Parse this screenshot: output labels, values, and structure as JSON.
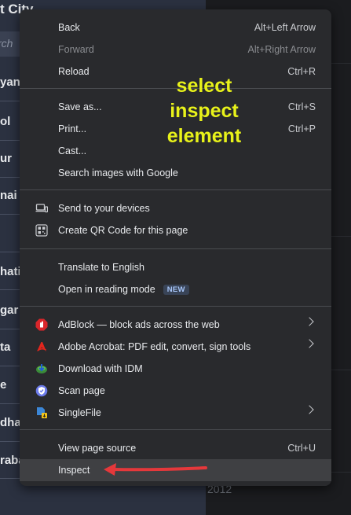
{
  "background": {
    "title_fragment": "t City",
    "search_placeholder_fragment": "rch",
    "cities": [
      "yana",
      "ol",
      "ur",
      "nai",
      "hati",
      "gar",
      "ta",
      "e",
      "dha",
      "raba"
    ],
    "year_fragment": "2012"
  },
  "annotation": {
    "line1": "select",
    "line2": "inspect",
    "line3": "element"
  },
  "menu": {
    "back": {
      "label": "Back",
      "shortcut": "Alt+Left Arrow"
    },
    "forward": {
      "label": "Forward",
      "shortcut": "Alt+Right Arrow"
    },
    "reload": {
      "label": "Reload",
      "shortcut": "Ctrl+R"
    },
    "save_as": {
      "label": "Save as...",
      "shortcut": "Ctrl+S"
    },
    "print": {
      "label": "Print...",
      "shortcut": "Ctrl+P"
    },
    "cast": {
      "label": "Cast..."
    },
    "search_images": {
      "label": "Search images with Google"
    },
    "send_devices": {
      "label": "Send to your devices",
      "icon": "devices-icon"
    },
    "qr_code": {
      "label": "Create QR Code for this page",
      "icon": "qr-code-icon"
    },
    "translate": {
      "label": "Translate to English"
    },
    "reading_mode": {
      "label": "Open in reading mode",
      "badge": "NEW"
    },
    "adblock": {
      "label": "AdBlock — block ads across the web",
      "icon": "adblock-icon",
      "color": "#d9262b"
    },
    "acrobat": {
      "label": "Adobe Acrobat: PDF edit, convert, sign tools",
      "icon": "acrobat-icon",
      "color": "#e2261d"
    },
    "idm": {
      "label": "Download with IDM",
      "icon": "idm-icon"
    },
    "scan": {
      "label": "Scan page",
      "icon": "scan-icon",
      "color": "#6c7bea"
    },
    "singlefile": {
      "label": "SingleFile",
      "icon": "singlefile-icon"
    },
    "view_source": {
      "label": "View page source",
      "shortcut": "Ctrl+U"
    },
    "inspect": {
      "label": "Inspect"
    }
  },
  "colors": {
    "annotation": "#e8f21a",
    "arrow": "#e5383b",
    "menu_bg": "#292a2d"
  }
}
